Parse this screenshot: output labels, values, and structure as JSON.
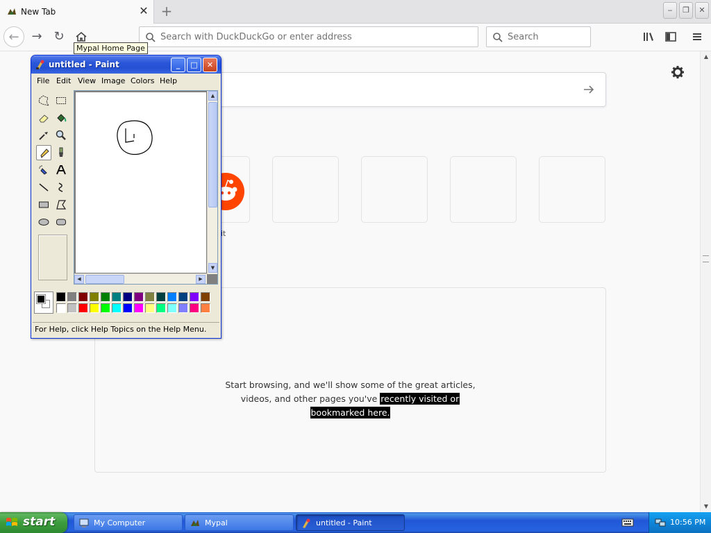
{
  "browser": {
    "tab": {
      "title": "New Tab",
      "close_glyph": "✕",
      "favicon": "mypal-icon"
    },
    "newtab_glyph": "+",
    "window_buttons": {
      "minimize": "‒",
      "restore": "❐",
      "close": "✕"
    },
    "nav": {
      "back": "←",
      "forward": "→",
      "reload": "↻",
      "home": "home-icon"
    },
    "tooltip": "Mypal Home Page",
    "urlbar": {
      "placeholder": "Search with DuckDuckGo or enter address",
      "value": ""
    },
    "searchbar": {
      "placeholder": "Search",
      "value": ""
    },
    "toolbar_icons": [
      "library-icon",
      "sidebar-icon",
      "menu-icon"
    ]
  },
  "newtab": {
    "search_arrow": "→",
    "tiles": [
      {
        "label": "it",
        "icon": "reddit-icon"
      },
      {
        "label": "",
        "icon": ""
      },
      {
        "label": "",
        "icon": ""
      },
      {
        "label": "",
        "icon": ""
      },
      {
        "label": "",
        "icon": ""
      }
    ],
    "highlights": {
      "line1": "Start browsing, and we'll show some of the great articles,",
      "line2_pre": "videos, and other pages you've ",
      "line2_sel": "recently visited or ",
      "line3_sel": "bookmarked here."
    }
  },
  "paint": {
    "title": "untitled - Paint",
    "buttons": {
      "minimize": "_",
      "maximize": "□",
      "close": "✕"
    },
    "menu": [
      "File",
      "Edit",
      "View",
      "Image",
      "Colors",
      "Help"
    ],
    "status": "For Help, click Help Topics on the Help Menu.",
    "selected_tool": "pencil",
    "tools": [
      "free-form-select",
      "select",
      "eraser",
      "fill",
      "pick-color",
      "magnifier",
      "pencil",
      "brush",
      "airbrush",
      "text",
      "line",
      "curve",
      "rectangle",
      "polygon",
      "ellipse",
      "rounded-rectangle"
    ],
    "palette_top": [
      "#000000",
      "#808080",
      "#800000",
      "#808000",
      "#008000",
      "#008080",
      "#000080",
      "#800080",
      "#808040",
      "#004040",
      "#0080ff",
      "#004080",
      "#8000ff",
      "#804000"
    ],
    "palette_bottom": [
      "#ffffff",
      "#c0c0c0",
      "#ff0000",
      "#ffff00",
      "#00ff00",
      "#00ffff",
      "#0000ff",
      "#ff00ff",
      "#ffff80",
      "#00ff80",
      "#80ffff",
      "#8080ff",
      "#ff0080",
      "#ff8040"
    ],
    "fg_color": "#000000",
    "bg_color": "#ffffff"
  },
  "taskbar": {
    "start": "start",
    "tasks": [
      {
        "label": "My Computer",
        "icon": "my-computer-icon",
        "active": false
      },
      {
        "label": "Mypal",
        "icon": "mypal-icon",
        "active": false
      },
      {
        "label": "untitled - Paint",
        "icon": "paint-icon",
        "active": true
      }
    ],
    "clock": "10:56 PM"
  }
}
